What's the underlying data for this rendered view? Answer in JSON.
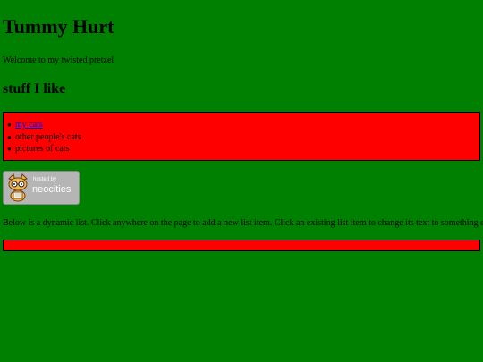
{
  "page": {
    "title": "Tummy Hurt",
    "welcome": "Welcome to my twisted pretzel",
    "section_heading": "stuff I like",
    "background_color": "#008000",
    "box_color": "#ff0000"
  },
  "likes": {
    "items": [
      {
        "label": "my cats",
        "is_link": true
      },
      {
        "label": "other people's cats",
        "is_link": false
      },
      {
        "label": "pictures of cats",
        "is_link": false
      }
    ]
  },
  "badge": {
    "hosted_by": "hosted by",
    "brand": "neocities",
    "icon": "neocities-cat-icon"
  },
  "dynamic": {
    "instructions": "Below is a dynamic list. Click anywhere on the page to add a new list item. Click an existing list item to change its text to something else."
  }
}
